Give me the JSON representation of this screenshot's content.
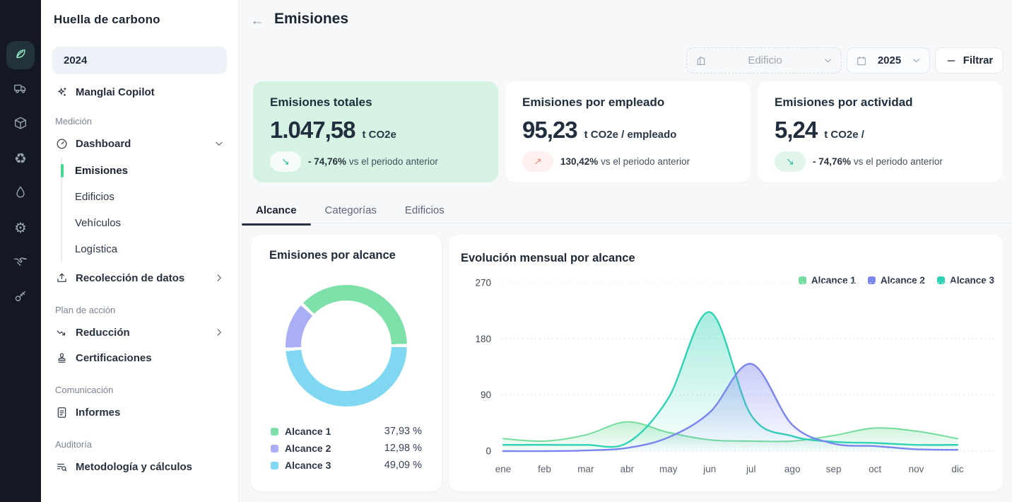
{
  "sidebar": {
    "title": "Huella de carbono",
    "year": "2024",
    "copilot": "Manglai Copilot",
    "sections": [
      {
        "label": "Medición"
      },
      {
        "label": "Plan de acción"
      },
      {
        "label": "Comunicación"
      },
      {
        "label": "Auditoría"
      }
    ],
    "nav": {
      "dashboard": "Dashboard",
      "emisiones": "Emisiones",
      "edificios": "Edificios",
      "vehiculos": "Vehículos",
      "logistica": "Logística",
      "recoleccion": "Recolección de datos",
      "reduccion": "Reducción",
      "certificaciones": "Certificaciones",
      "informes": "Informes",
      "metodologia": "Metodología y cálculos"
    }
  },
  "rail": {
    "icons": [
      "leaf",
      "truck",
      "package",
      "recycle",
      "droplet",
      "settings",
      "handshake",
      "key"
    ],
    "active": "leaf"
  },
  "header": {
    "back": "←",
    "title": "Emisiones"
  },
  "filters": {
    "building": {
      "label": "Edificio"
    },
    "year": {
      "label": "2025"
    },
    "filter_button": {
      "label": "Filtrar"
    }
  },
  "stats": [
    {
      "title": "Emisiones totales",
      "value": "1.047,58",
      "unit": "t CO2e",
      "arrow": "↘",
      "delta": "- 74,76%",
      "suffix": "vs el periodo anterior",
      "trend": "down"
    },
    {
      "title": "Emisiones por empleado",
      "value": "95,23",
      "unit": "t CO2e / empleado",
      "arrow": "↗",
      "delta": "130,42%",
      "suffix": "vs el periodo anterior",
      "trend": "up"
    },
    {
      "title": "Emisiones por actividad",
      "value": "5,24",
      "unit": "t CO2e /",
      "arrow": "↘",
      "delta": "- 74,76%",
      "suffix": "vs el periodo anterior",
      "trend": "down"
    }
  ],
  "tabs": [
    {
      "label": "Alcance",
      "active": true
    },
    {
      "label": "Categorías",
      "active": false
    },
    {
      "label": "Edificios",
      "active": false
    }
  ],
  "chart_data": [
    {
      "type": "pie",
      "donut": true,
      "title": "Emisiones por alcance",
      "labels": [
        "Alcance 1",
        "Alcance 2",
        "Alcance 3"
      ],
      "values": [
        37.93,
        12.98,
        49.09
      ],
      "display_values": [
        "37,93 %",
        "12,98 %",
        "49,09 %"
      ],
      "colors": [
        "#7de0a8",
        "#a9aef5",
        "#7fd7f1"
      ],
      "draw_order": [
        0,
        2,
        1
      ],
      "legend_position": "bottom"
    },
    {
      "type": "area",
      "title": "Evolución mensual por alcance",
      "x": [
        "ene",
        "feb",
        "mar",
        "abr",
        "may",
        "jun",
        "jul",
        "ago",
        "sep",
        "oct",
        "nov",
        "dic"
      ],
      "ylim": [
        0,
        270
      ],
      "yticks": [
        0,
        90,
        180,
        270
      ],
      "grid": "dotted-horizontal",
      "legend_position": "top-right",
      "series": [
        {
          "name": "Alcance 1",
          "color": "#74dd9d",
          "values": [
            20,
            16,
            26,
            47,
            30,
            18,
            16,
            16,
            25,
            37,
            32,
            20
          ]
        },
        {
          "name": "Alcance 2",
          "color": "#7b85ee",
          "values": [
            0,
            0,
            1,
            5,
            22,
            62,
            140,
            42,
            12,
            8,
            3,
            2
          ]
        },
        {
          "name": "Alcance 3",
          "color": "#2ed3b4",
          "values": [
            10,
            10,
            10,
            13,
            85,
            223,
            58,
            24,
            15,
            13,
            10,
            10
          ]
        }
      ]
    }
  ]
}
